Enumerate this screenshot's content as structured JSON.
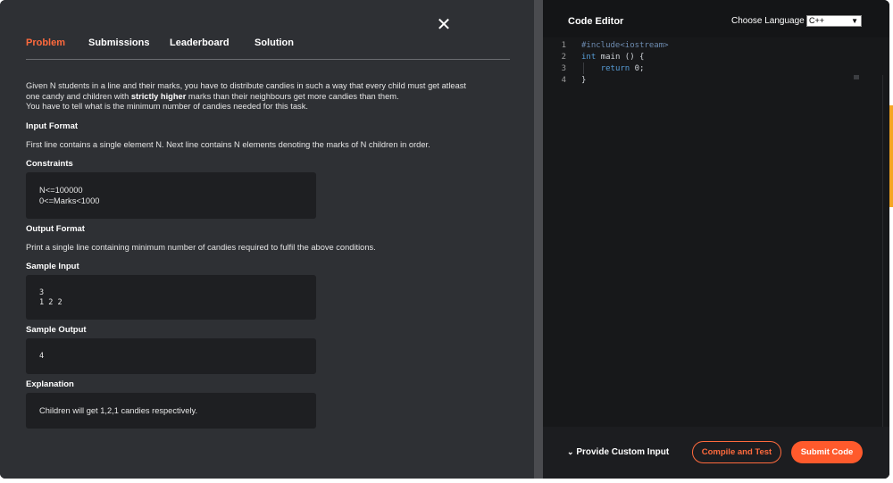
{
  "left": {
    "close_icon": "close-icon",
    "tabs": [
      {
        "label": "Problem",
        "active": true
      },
      {
        "label": "Submissions",
        "active": false
      },
      {
        "label": "Leaderboard",
        "active": false
      },
      {
        "label": "Solution",
        "active": false
      }
    ],
    "statement": {
      "line1": "Given N students in a line and their marks, you have to distribute candies in such a way that every child must get atleast",
      "line2_pre": "one candy and children with ",
      "line2_bold": "strictly higher",
      "line2_post": " marks than their neighbours get more candies than them.",
      "line3": "You have to tell what is the minimum number of candies needed for this task."
    },
    "input_format": {
      "heading": "Input Format",
      "text": "First line contains a single element N. Next line contains N elements denoting the marks of N children in order."
    },
    "constraints": {
      "heading": "Constraints",
      "lines": [
        "N<=100000",
        "0<=Marks<1000"
      ]
    },
    "output_format": {
      "heading": "Output Format",
      "text": "Print a single line containing minimum number of candies required to fulfil the above conditions."
    },
    "sample_input": {
      "heading": "Sample Input",
      "lines": [
        "3",
        "1 2 2"
      ]
    },
    "sample_output": {
      "heading": "Sample Output",
      "value": "4"
    },
    "explanation": {
      "heading": "Explanation",
      "text": "Children will get 1,2,1 candies respectively."
    }
  },
  "editor": {
    "title": "Code Editor",
    "language_label": "Choose Language",
    "language_selected": "C++",
    "lines": [
      {
        "num": "1",
        "prefix": "#include",
        "rest": "<iostream>"
      },
      {
        "num": "2",
        "kw": "int",
        "rest": " main () {"
      },
      {
        "num": "3",
        "indent": "    ",
        "kw": "return",
        "rest": " 0;"
      },
      {
        "num": "4",
        "rest": "}"
      }
    ]
  },
  "footer": {
    "custom_input_label": "Provide Custom Input",
    "compile_label": "Compile and Test",
    "submit_label": "Submit Code"
  },
  "colors": {
    "accent": "#ff6a3d",
    "submit_bg": "#ff5a2c",
    "panel_bg": "#2e3034",
    "editor_bg": "#17181a",
    "keyword": "#569cd6"
  }
}
